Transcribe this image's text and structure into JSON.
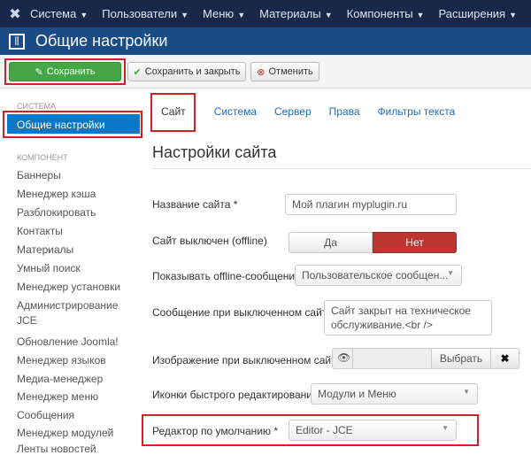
{
  "navbar": {
    "items": [
      "Система",
      "Пользователи",
      "Меню",
      "Материалы",
      "Компоненты",
      "Расширения"
    ]
  },
  "page_title": "Общие настройки",
  "toolbar": {
    "save": "Сохранить",
    "save_close": "Сохранить и закрыть",
    "cancel": "Отменить"
  },
  "sidebar": {
    "system_header": "Система",
    "active_item": "Общие настройки",
    "component_header": "Компонент",
    "items": [
      "Баннеры",
      "Менеджер кэша",
      "Разблокировать",
      "Контакты",
      "Материалы",
      "Умный поиск",
      "Менеджер установки",
      "Администрирование JCE",
      "Обновление Joomla!",
      "Менеджер языков",
      "Медиа-менеджер",
      "Менеджер меню",
      "Сообщения",
      "Менеджер модулей",
      "Ленты новостей"
    ]
  },
  "tabs": [
    "Сайт",
    "Система",
    "Сервер",
    "Права",
    "Фильтры текста"
  ],
  "section_title": "Настройки сайта",
  "form": {
    "site_name_label": "Название сайта *",
    "site_name_value": "Мой плагин myplugin.ru",
    "offline_label": "Сайт выключен (offline)",
    "offline_yes": "Да",
    "offline_no": "Нет",
    "show_offline_label": "Показывать offline-сообщение",
    "show_offline_value": "Пользовательское сообщен...",
    "offline_msg_label": "Сообщение при выключенном сайте",
    "offline_msg_value": "Сайт закрыт на техническое обслуживание.<br />",
    "offline_img_label": "Изображение при выключенном сайте",
    "select_button": "Выбрать",
    "edit_icons_label": "Иконки быстрого редактирования",
    "edit_icons_value": "Модули и Меню",
    "editor_label": "Редактор по умолчанию *",
    "editor_value": "Editor - JCE"
  }
}
